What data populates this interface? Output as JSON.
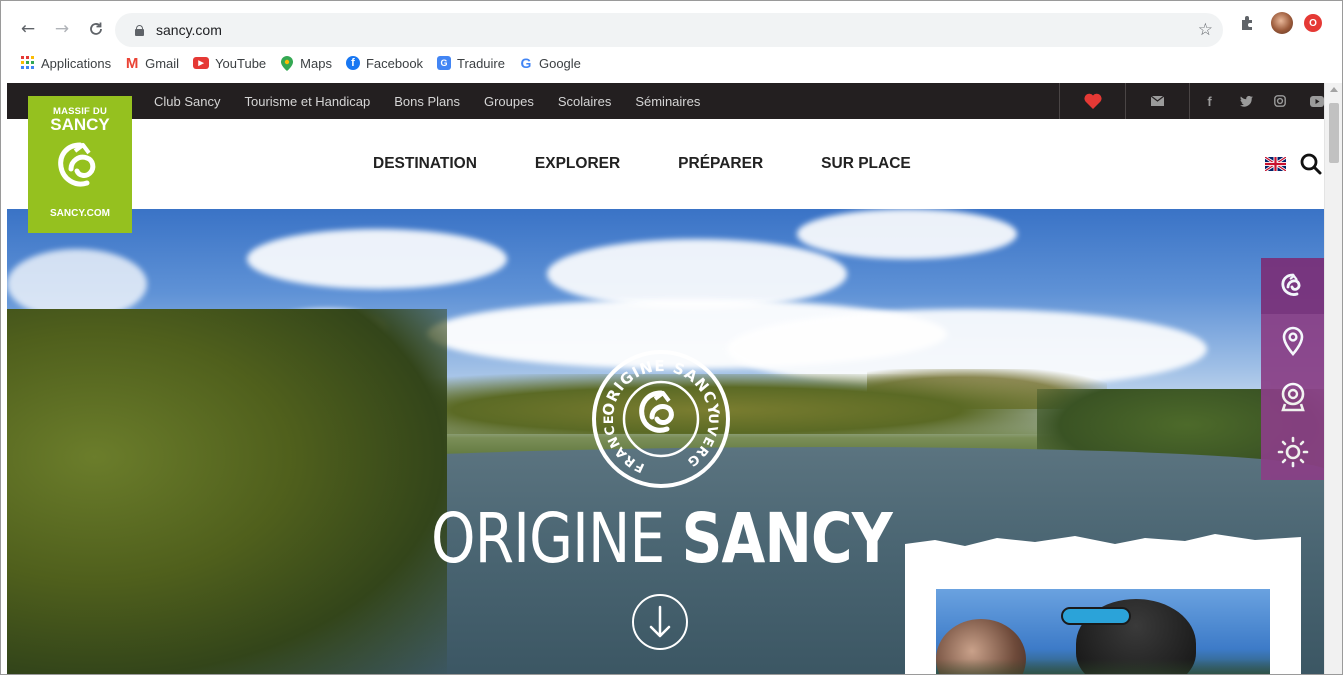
{
  "browser": {
    "url": "sancy.com",
    "bookmarks": [
      {
        "label": "Applications",
        "icon": "apps-grid-icon"
      },
      {
        "label": "Gmail",
        "icon": "gmail-icon"
      },
      {
        "label": "YouTube",
        "icon": "youtube-icon"
      },
      {
        "label": "Maps",
        "icon": "maps-pin-icon"
      },
      {
        "label": "Facebook",
        "icon": "facebook-icon"
      },
      {
        "label": "Traduire",
        "icon": "translate-icon"
      },
      {
        "label": "Google",
        "icon": "google-icon"
      }
    ]
  },
  "topbar": {
    "links": [
      "Club Sancy",
      "Tourisme et Handicap",
      "Bons Plans",
      "Groupes",
      "Scolaires",
      "Séminaires"
    ],
    "icons": [
      "heart-icon",
      "mail-icon",
      "facebook-icon",
      "twitter-icon",
      "instagram-icon",
      "youtube-icon"
    ]
  },
  "logo": {
    "line1": "MASSIF DU",
    "line2": "SANCY",
    "footer": "SANCY.COM"
  },
  "nav": {
    "items": [
      "DESTINATION",
      "EXPLORER",
      "PRÉPARER",
      "SUR PLACE"
    ]
  },
  "hero": {
    "title_light": "ORIGINE",
    "title_bold": "SANCY",
    "badge_top": "ORIGINE SANCY",
    "badge_left": "FRANCE",
    "badge_right": "AUVERGNE"
  },
  "sidepanel": {
    "items": [
      "sancy-swirl-icon",
      "location-pin-icon",
      "webcam-icon",
      "weather-sun-icon"
    ]
  },
  "colors": {
    "brand_green": "#95c11f",
    "topbar_bg": "#231f20",
    "side_purple": "#8a3f86",
    "heart_red": "#e53935"
  }
}
